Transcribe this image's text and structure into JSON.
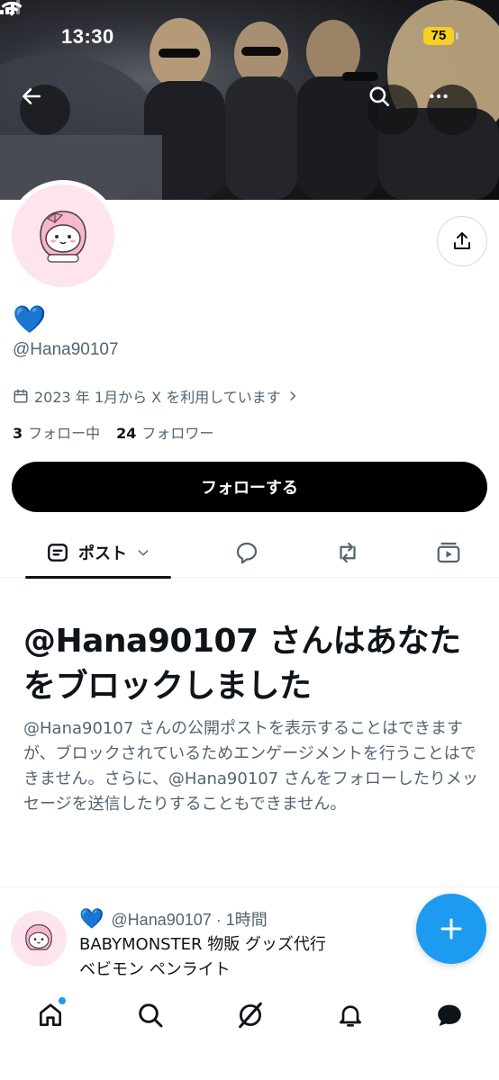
{
  "status_bar": {
    "time": "13:30",
    "battery": "75"
  },
  "header": {
    "back_icon": "arrow-left-icon",
    "search_icon": "search-icon",
    "more_icon": "more-horizontal-icon"
  },
  "profile": {
    "display_name": "💙",
    "handle": "@Hana90107",
    "joined": "2023 年 1月から X を利用しています",
    "following_count": "3",
    "following_label": "フォロー中",
    "followers_count": "24",
    "followers_label": "フォロワー",
    "follow_button": "フォローする",
    "share_icon": "share-icon"
  },
  "tabs": [
    {
      "label": "ポスト",
      "icon": "posts-icon",
      "active": true
    },
    {
      "label": "",
      "icon": "reply-icon",
      "active": false
    },
    {
      "label": "",
      "icon": "repost-icon",
      "active": false
    },
    {
      "label": "",
      "icon": "media-icon",
      "active": false
    }
  ],
  "blocked": {
    "title": "@Hana90107 さんはあなたをブロックしました",
    "body": "@Hana90107 さんの公開ポストを表示することはできますが、ブロックされているためエンゲージメントを行うことはできません。さらに、@Hana90107 さんをフォローしたりメッセージを送信したりすることもできません。"
  },
  "post": {
    "name": "💙",
    "handle_time": "@Hana90107 · 1時間",
    "line1": "BABYMONSTER 物販 グッズ代行",
    "line2": "ベビモン ペンライト"
  },
  "fab_icon": "compose-plus-icon",
  "bottom_nav": [
    "home-icon",
    "search-icon",
    "grok-icon",
    "bell-icon",
    "mail-icon"
  ],
  "colors": {
    "accent": "#1d9bf0",
    "text": "#0f1419",
    "secondary": "#536471",
    "heart": "#1d6ff2"
  }
}
